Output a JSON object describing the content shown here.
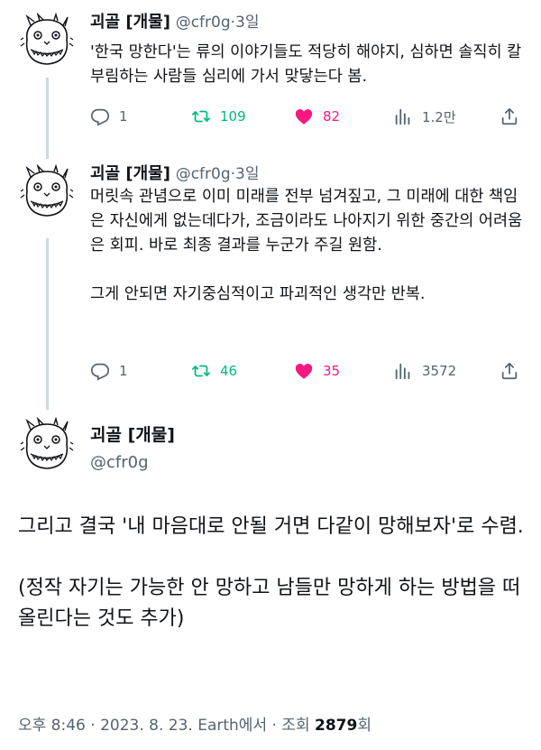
{
  "tweets": [
    {
      "author_name": "괴골 [개물]",
      "handle": "@cfr0g",
      "time": "3일",
      "text": "'한국 망한다'는 류의 이야기들도 적당히 해야지, 심하면 솔직히 칼부림하는 사람들 심리에 가서 맞닿는다 봄.",
      "replies": "1",
      "retweets": "109",
      "likes": "82",
      "views": "1.2만"
    },
    {
      "author_name": "괴골 [개물]",
      "handle": "@cfr0g",
      "time": "3일",
      "text": "머릿속 관념으로 이미 미래를 전부 넘겨짚고, 그 미래에 대한 책임은 자신에게 없는데다가, 조금이라도 나아지기 위한 중간의 어려움은 회피. 바로 최종 결과를 누군가 주길 원함.",
      "text_2": "그게 안되면 자기중심적이고 파괴적인 생각만 반복.",
      "replies": "1",
      "retweets": "46",
      "likes": "35",
      "views": "3572"
    }
  ],
  "main_tweet": {
    "author_name": "괴골 [개물]",
    "handle": "@cfr0g",
    "text": "그리고 결국 '내 마음대로 안될 거면 다같이 망해보자'로 수렴.",
    "text_2": "(정작 자기는 가능한 안 망하고 남들만 망하게 하는 방법을 떠올린다는 것도 추가)",
    "time": "오후 8:46",
    "date": "2023. 8. 23.",
    "source": "Earth에서",
    "views_label": "조회",
    "views": "2879",
    "views_suffix": "회"
  },
  "colors": {
    "text": "#0f1419",
    "secondary": "#536471",
    "retweet": "#00ba7c",
    "like": "#f91880",
    "thread_line": "#cfd9de"
  },
  "icons": [
    "reply-icon",
    "retweet-icon",
    "like-icon",
    "views-icon",
    "share-icon",
    "avatar-doodle"
  ]
}
